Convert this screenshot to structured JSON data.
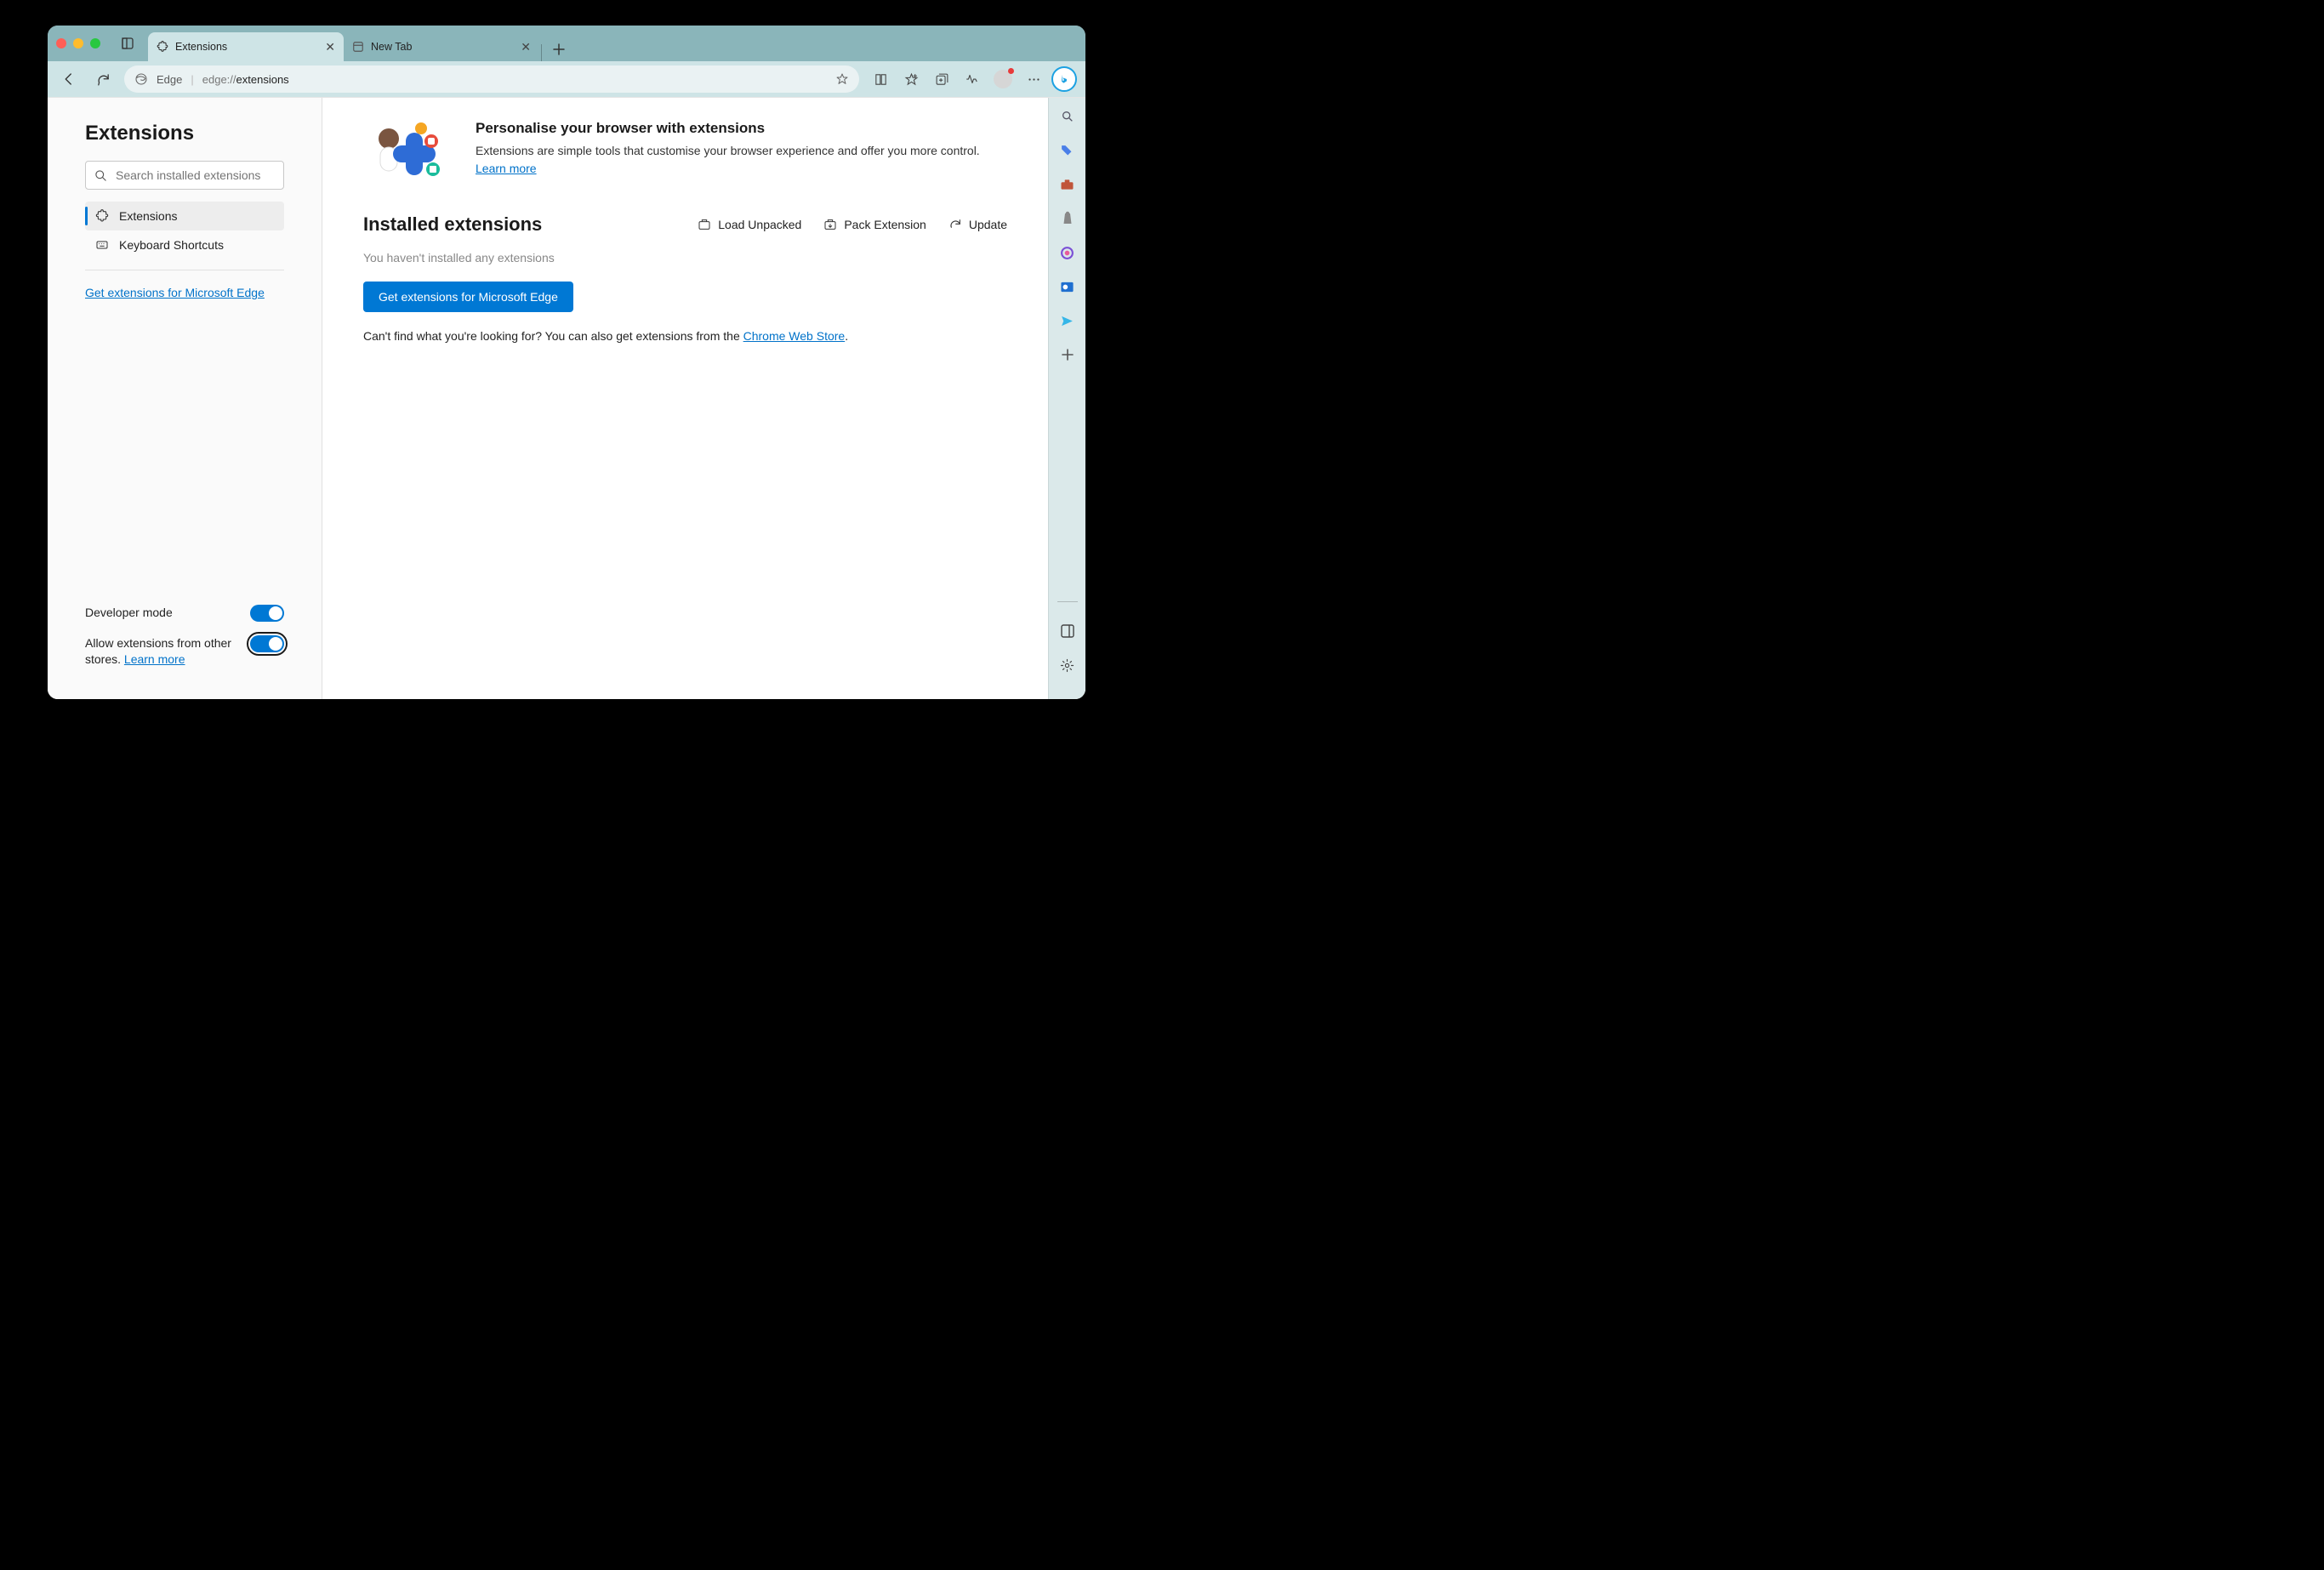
{
  "tabs": [
    {
      "title": "Extensions",
      "active": true
    },
    {
      "title": "New Tab",
      "active": false
    }
  ],
  "address": {
    "browser_label": "Edge",
    "url_prefix": "edge://",
    "url_path": "extensions"
  },
  "sidebar": {
    "title": "Extensions",
    "search_placeholder": "Search installed extensions",
    "nav": [
      {
        "label": "Extensions",
        "active": true
      },
      {
        "label": "Keyboard Shortcuts",
        "active": false
      }
    ],
    "get_link": "Get extensions for Microsoft Edge",
    "toggles": {
      "dev_mode": {
        "label": "Developer mode",
        "on": true
      },
      "other_stores": {
        "label_pre": "Allow extensions from other stores. ",
        "learn_more": "Learn more",
        "on": true
      }
    }
  },
  "main": {
    "hero": {
      "title": "Personalise your browser with extensions",
      "desc": "Extensions are simple tools that customise your browser experience and offer you more control. ",
      "learn_more": "Learn more"
    },
    "installed": {
      "heading": "Installed extensions",
      "actions": {
        "load": "Load Unpacked",
        "pack": "Pack Extension",
        "update": "Update"
      },
      "empty": "You haven't installed any extensions",
      "button": "Get extensions for Microsoft Edge",
      "footer_pre": "Can't find what you're looking for? You can also get extensions from the ",
      "footer_link": "Chrome Web Store",
      "footer_post": "."
    }
  }
}
